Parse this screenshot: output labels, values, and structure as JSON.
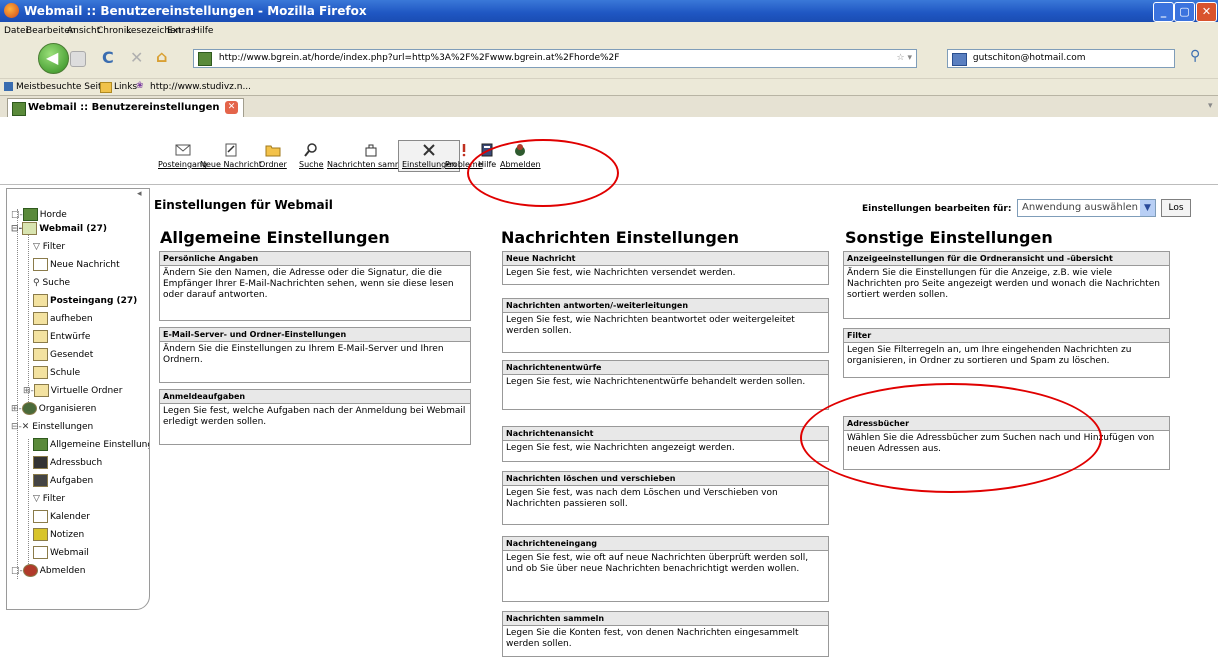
{
  "window": {
    "title": "Webmail :: Benutzereinstellungen - Mozilla Firefox"
  },
  "menu": [
    "Datei",
    "Bearbeiten",
    "Ansicht",
    "Chronik",
    "Lesezeichen",
    "Extras",
    "Hilfe"
  ],
  "nav": {
    "url": "http://www.bgrein.at/horde/index.php?url=http%3A%2F%2Fwww.bgrein.at%2Fhorde%2F",
    "search_engine_value": "gutschiton@hotmail.com"
  },
  "bookmarks": [
    "Meistbesuchte Seiten",
    "Links",
    "http://www.studivz.n..."
  ],
  "tab": {
    "label": "Webmail :: Benutzereinstellungen"
  },
  "toolbar": {
    "items": [
      {
        "label": "Posteingang",
        "icon": "inbox-icon"
      },
      {
        "label": "Neue Nachricht",
        "icon": "compose-icon"
      },
      {
        "label": "Ordner",
        "icon": "folder-icon"
      },
      {
        "label": "Suche",
        "icon": "search-icon"
      },
      {
        "label": "Nachrichten sammeln",
        "icon": "fetch-mail-icon"
      },
      {
        "label": "Einstellungen",
        "icon": "tools-icon"
      },
      {
        "label": "Probleme",
        "icon": "problem-icon"
      },
      {
        "label": "Hilfe",
        "icon": "help-icon"
      },
      {
        "label": "Abmelden",
        "icon": "logout-icon"
      }
    ]
  },
  "sidebar": {
    "items": [
      {
        "label": "Horde"
      },
      {
        "label": "Webmail (27)"
      },
      {
        "label": "Filter"
      },
      {
        "label": "Neue Nachricht"
      },
      {
        "label": "Suche"
      },
      {
        "label": "Posteingang (27)"
      },
      {
        "label": "aufheben"
      },
      {
        "label": "Entwürfe"
      },
      {
        "label": "Gesendet"
      },
      {
        "label": "Schule"
      },
      {
        "label": "Virtuelle Ordner"
      },
      {
        "label": "Organisieren"
      },
      {
        "label": "Einstellungen"
      },
      {
        "label": "Allgemeine Einstellungen"
      },
      {
        "label": "Adressbuch"
      },
      {
        "label": "Aufgaben"
      },
      {
        "label": "Filter"
      },
      {
        "label": "Kalender"
      },
      {
        "label": "Notizen"
      },
      {
        "label": "Webmail"
      },
      {
        "label": "Abmelden"
      }
    ]
  },
  "page": {
    "title": "Einstellungen für Webmail",
    "edit_for_label": "Einstellungen bearbeiten für:",
    "select_value": "Anwendung auswählen",
    "go_label": "Los"
  },
  "columns": [
    {
      "heading": "Allgemeine Einstellungen",
      "boxes": [
        {
          "title": "Persönliche Angaben",
          "text": "Ändern Sie den Namen, die Adresse oder die Signatur, die die Empfänger Ihrer E-Mail-Nachrichten sehen, wenn sie diese lesen oder darauf antworten."
        },
        {
          "title": "E-Mail-Server- und Ordner-Einstellungen",
          "text": "Ändern Sie die Einstellungen zu Ihrem E-Mail-Server und Ihren Ordnern."
        },
        {
          "title": "Anmeldeaufgaben",
          "text": "Legen Sie fest, welche Aufgaben nach der Anmeldung bei Webmail erledigt werden sollen."
        }
      ]
    },
    {
      "heading": "Nachrichten Einstellungen",
      "boxes": [
        {
          "title": "Neue Nachricht",
          "text": "Legen Sie fest, wie Nachrichten versendet werden."
        },
        {
          "title": "Nachrichten antworten/-weiterleitungen",
          "text": "Legen Sie fest, wie Nachrichten beantwortet oder weitergeleitet werden sollen."
        },
        {
          "title": "Nachrichtenentwürfe",
          "text": "Legen Sie fest, wie Nachrichtenentwürfe behandelt werden sollen."
        },
        {
          "title": "Nachrichtenansicht",
          "text": "Legen Sie fest, wie Nachrichten angezeigt werden."
        },
        {
          "title": "Nachrichten löschen und verschieben",
          "text": "Legen Sie fest, was nach dem Löschen und Verschieben von Nachrichten passieren soll."
        },
        {
          "title": "Nachrichteneingang",
          "text": "Legen Sie fest, wie oft auf neue Nachrichten überprüft werden soll, und ob Sie über neue Nachrichten benachrichtigt werden wollen."
        },
        {
          "title": "Nachrichten sammeln",
          "text": "Legen Sie die Konten fest, von denen Nachrichten eingesammelt werden sollen."
        }
      ]
    },
    {
      "heading": "Sonstige Einstellungen",
      "boxes": [
        {
          "title": "Anzeigeeinstellungen für die Ordneransicht und -übersicht",
          "text": "Ändern Sie die Einstellungen für die Anzeige, z.B. wie viele Nachrichten pro Seite angezeigt werden und wonach die Nachrichten sortiert werden sollen."
        },
        {
          "title": "Filter",
          "text": "Legen Sie Filterregeln an, um Ihre eingehenden Nachrichten zu organisieren, in Ordner zu sortieren und Spam zu löschen."
        },
        {
          "title": "Adressbücher",
          "text": "Wählen Sie die Adressbücher zum Suchen nach und Hinzufügen von neuen Adressen aus."
        }
      ]
    }
  ],
  "colors": {
    "titlebar": "#1f56c2",
    "highlight": "#e00000",
    "box_header": "#e8e8e8"
  }
}
